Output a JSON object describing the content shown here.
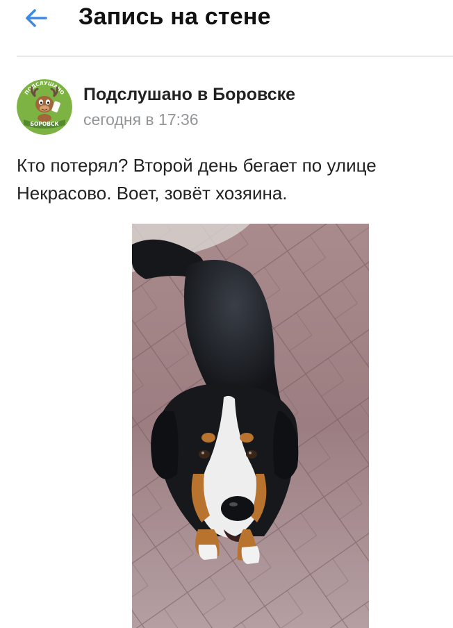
{
  "header": {
    "title": "Запись на стене",
    "back_icon": "arrow-left-icon",
    "accent_color": "#3f8ae0"
  },
  "post": {
    "group_name": "Подслушано в Боровске",
    "time": "сегодня в 17:36",
    "text": "Кто потерял? Второй день бегает по улице Некрасово. Воет, зовёт хозяина.",
    "avatar": {
      "icon": "moose-mascot-logo",
      "text_top": "ПОДСЛУШАНО",
      "text_bottom": "БОРОВСК",
      "bg_color": "#7cb342"
    },
    "photo": {
      "icon": "dog-photo"
    }
  }
}
